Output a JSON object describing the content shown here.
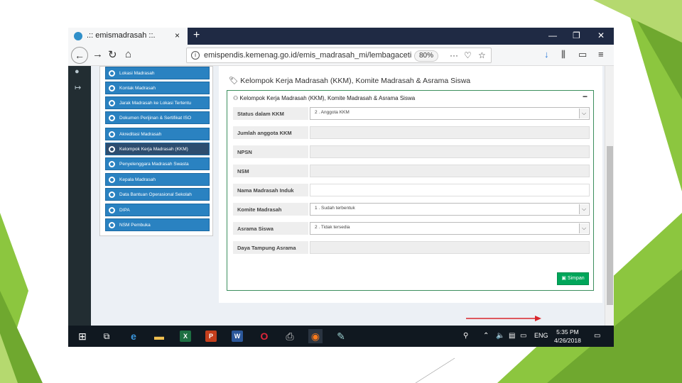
{
  "browser": {
    "tab_title": ".:: emismadrasah ::.",
    "tab_close": "×",
    "new_tab": "+",
    "win_min": "—",
    "win_max": "❐",
    "win_close": "✕",
    "url": "emispendis.kemenag.go.id/emis_madrasah_mi/lembagaceti",
    "zoom": "80%"
  },
  "sidebar": {
    "items": [
      {
        "label": "Lokasi Madrasah",
        "active": false
      },
      {
        "label": "Kontak Madrasah",
        "active": false
      },
      {
        "label": "Jarak Madrasah ke Lokasi Tertentu",
        "active": false
      },
      {
        "label": "Dokumen Perijinan & Sertifikat ISO",
        "active": false
      },
      {
        "label": "Akreditasi Madrasah",
        "active": false
      },
      {
        "label": "Kelompok Kerja Madrasah (KKM)",
        "active": true
      },
      {
        "label": "Penyelenggara Madrasah Swasta",
        "active": false
      },
      {
        "label": "Kepala Madrasah",
        "active": false
      },
      {
        "label": "Data Bantuan Operasional Sekolah",
        "active": false
      },
      {
        "label": "DIPA",
        "active": false
      },
      {
        "label": "NSM Pembuka",
        "active": false
      }
    ]
  },
  "main": {
    "heading": "Kelompok Kerja Madrasah (KKM), Komite Madrasah & Asrama Siswa",
    "panel_title": "Kelompok Kerja Madrasah (KKM), Komite Madrasah & Asrama Siswa",
    "panel_minimize": "−",
    "fields": [
      {
        "label": "Status dalam KKM",
        "value": "2 . Anggota KKM",
        "select": true
      },
      {
        "label": "Jumlah anggota KKM",
        "value": "",
        "select": false
      },
      {
        "label": "NPSN",
        "value": "",
        "select": false
      },
      {
        "label": "NSM",
        "value": "",
        "select": false
      },
      {
        "label": "Nama Madrasah Induk",
        "value": "",
        "select": false
      },
      {
        "label": "Komite Madrasah",
        "value": "1 . Sudah terbentuk",
        "select": true
      },
      {
        "label": "Asrama Siswa",
        "value": "2 . Tidak tersedia",
        "select": true
      },
      {
        "label": "Daya Tampung Asrama",
        "value": "",
        "select": false
      }
    ],
    "save_label": "Simpan"
  },
  "taskbar": {
    "lang": "ENG",
    "time": "5:35 PM",
    "date": "4/26/2018"
  },
  "colors": {
    "sidebar_item": "#2a82c1",
    "sidebar_active": "#2d4d6f",
    "panel_border": "#3c8f5e",
    "save_button": "#00a65a",
    "arrow": "#d9262c",
    "deco_green": "#8cc63f"
  }
}
